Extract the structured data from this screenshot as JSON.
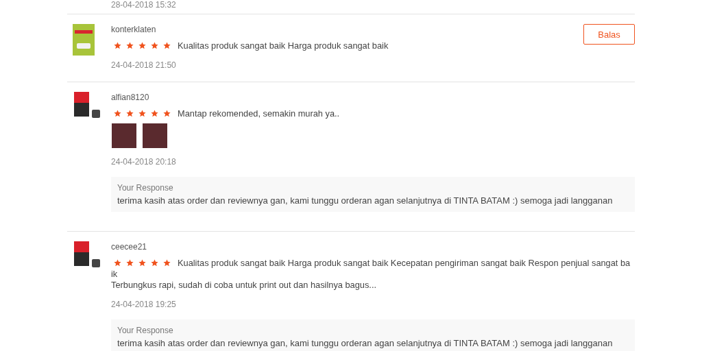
{
  "previous_date": "28-04-2018 15:32",
  "reviews": [
    {
      "username": "konterklaten",
      "stars": 5,
      "comment_lines": [
        "Kualitas produk sangat baik Harga produk sangat baik"
      ],
      "date": "24-04-2018 21:50",
      "reply_button": "Balas",
      "thumbnail": {
        "kind": "usb-drive"
      }
    },
    {
      "username": "alfian8120",
      "stars": 5,
      "comment_lines": [
        "Mantap rekomended, semakin murah ya.."
      ],
      "photos": [
        {
          "kind": "photo"
        },
        {
          "kind": "photo"
        }
      ],
      "date": "24-04-2018 20:18",
      "response": {
        "label": "Your Response",
        "text": "terima kasih atas order dan reviewnya gan, kami tunggu orderan agan selanjutnya di TINTA BATAM :) semoga jadi langganan"
      },
      "thumbnail": {
        "kind": "ink-cartridge"
      }
    },
    {
      "username": "ceecee21",
      "stars": 5,
      "comment_lines": [
        "Kualitas produk sangat baik Harga produk sangat baik Kecepatan pengiriman sangat baik Respon penjual sangat ba",
        "ik",
        "Terbungkus rapi, sudah di coba untuk print out dan hasilnya bagus..."
      ],
      "date": "24-04-2018 19:25",
      "response": {
        "label": "Your Response",
        "text": "terima kasih atas order dan reviewnya gan, kami tunggu orderan agan selanjutnya di TINTA BATAM :) semoga jadi langganan"
      },
      "thumbnail": {
        "kind": "ink-cartridge"
      }
    }
  ]
}
